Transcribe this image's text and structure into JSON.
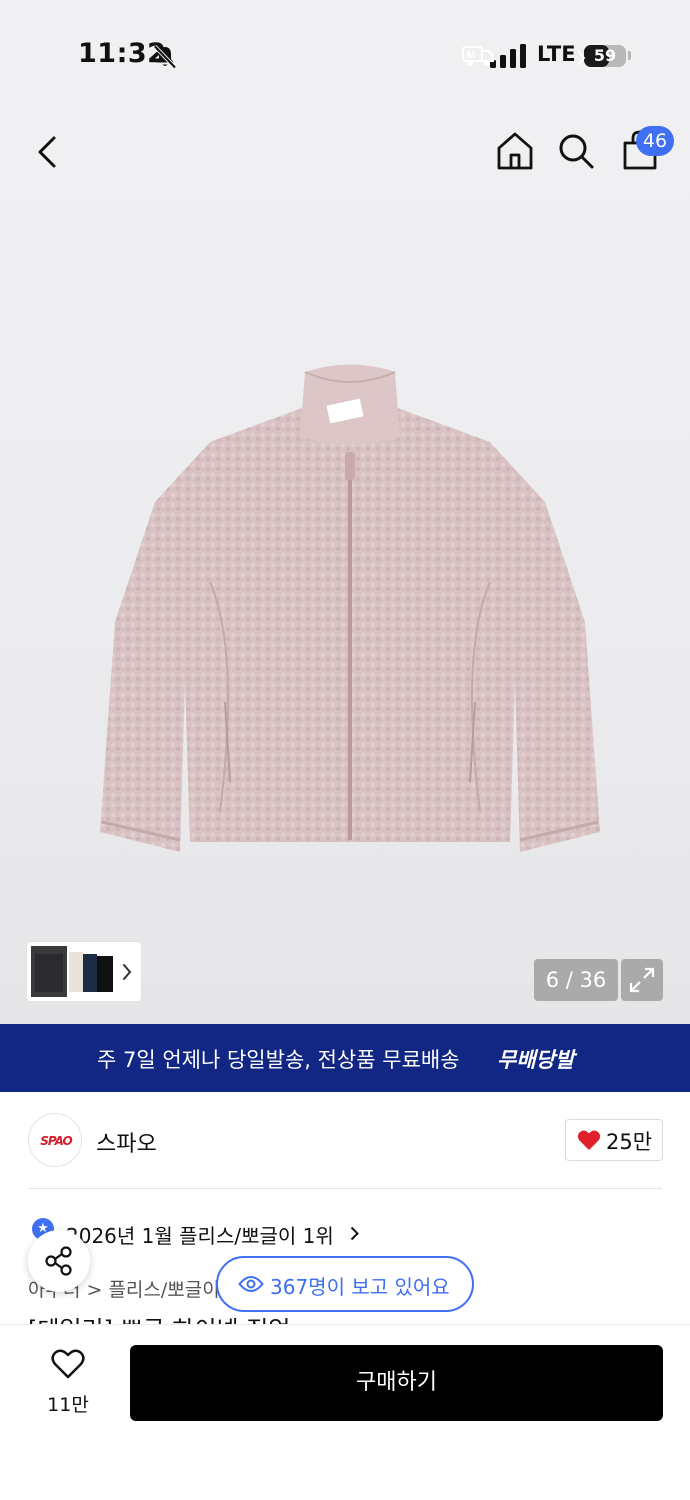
{
  "status_bar": {
    "time": "11:32",
    "network": "LTE",
    "battery": "59",
    "battery_level": 0.59
  },
  "nav": {
    "cart_count": "46"
  },
  "gallery": {
    "counter": "6 / 36"
  },
  "promo": {
    "text": "주 7일 언제나 당일발송, 전상품 무료배송",
    "brand": "무배당발"
  },
  "brand": {
    "logo_text": "SPAO",
    "name": "스파오",
    "like_count": "25만"
  },
  "ranking": {
    "text": "2026년 1월 플리스/뽀글이 1위"
  },
  "breadcrumb": {
    "text": "아우터 > 플리스/뽀글이"
  },
  "product": {
    "title": "[데일리] 뽀글 하이넥 집업"
  },
  "viewers": {
    "text": "367명이 보고 있어요"
  },
  "bottom_bar": {
    "wish_count": "11만",
    "buy_label": "구매하기"
  },
  "colors": {
    "accent": "#3f6ff2",
    "promo_bg": "#122683",
    "brand_red": "#d5202c",
    "buy_bg": "#000000"
  },
  "icons": [
    "back-arrow-icon",
    "home-icon",
    "search-icon",
    "shopping-bag-icon",
    "bell-slash-icon",
    "signal-icon",
    "expand-icon",
    "heart-icon",
    "share-icon",
    "eye-icon",
    "truck-icon",
    "star-icon"
  ]
}
